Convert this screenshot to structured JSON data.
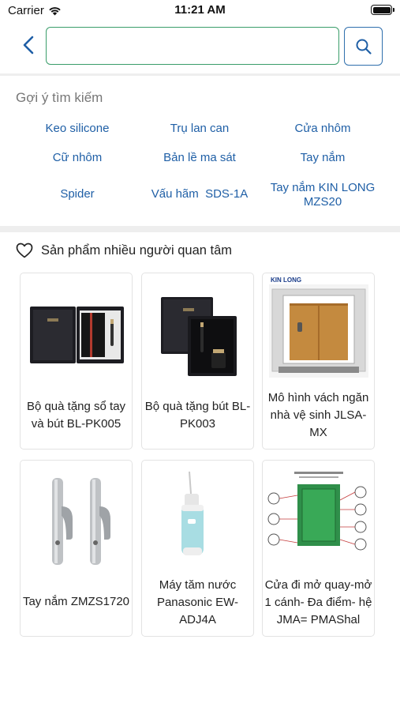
{
  "status_bar": {
    "carrier": "Carrier",
    "time": "11:21 AM"
  },
  "search": {
    "value": "",
    "placeholder": ""
  },
  "suggestions": {
    "title": "Gợi ý tìm kiếm",
    "items": [
      {
        "label": "Keo silicone"
      },
      {
        "label": "Trụ lan can"
      },
      {
        "label": "Cửa nhôm"
      },
      {
        "label": "Cữ nhôm"
      },
      {
        "label": "Bản lề ma sát"
      },
      {
        "label": "Tay nắm"
      },
      {
        "label": "Spider"
      },
      {
        "label": "Vấu hãm  SDS-1A"
      },
      {
        "label": "Tay nắm KIN LONG MZS20"
      }
    ]
  },
  "popular": {
    "title": "Sản phẩm nhiều người quan tâm",
    "products": [
      {
        "name": "Bộ quà tặng sổ tay và bút BL-PK005"
      },
      {
        "name": "Bộ quà tặng bút BL-PK003"
      },
      {
        "name": "Mô hình vách ngăn nhà vệ sinh JLSA-MX",
        "image_text": "KIN LONG"
      },
      {
        "name": "Tay nắm ZMZS1720"
      },
      {
        "name": "Máy tăm nước Panasonic EW-ADJ4A"
      },
      {
        "name": "Cửa đi mở quay-mở 1 cánh- Đa điểm- hệ JMA= PMAShal"
      }
    ]
  },
  "colors": {
    "accent": "#1f5fa6",
    "input_border": "#3a9d6a"
  }
}
